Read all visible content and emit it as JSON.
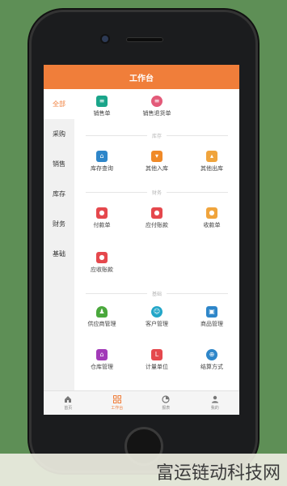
{
  "header": {
    "title": "工作台"
  },
  "sidebar": {
    "items": [
      {
        "label": "全部",
        "active": true
      },
      {
        "label": "采购"
      },
      {
        "label": "销售"
      },
      {
        "label": "库存"
      },
      {
        "label": "财务"
      },
      {
        "label": "基础"
      }
    ]
  },
  "sections": {
    "inventory": "库存",
    "finance": "财务",
    "basic": "基础"
  },
  "modules": {
    "sales_order": {
      "label": "销售单",
      "icon": "clipboard-icon",
      "color": "#1aa58a"
    },
    "sales_return": {
      "label": "销售退货单",
      "icon": "return-list-icon",
      "color": "#e35a79"
    },
    "stock_query": {
      "label": "库存查询",
      "icon": "house-search-icon",
      "color": "#2e86c9"
    },
    "other_in": {
      "label": "其他入库",
      "icon": "box-in-icon",
      "color": "#f08a28"
    },
    "other_out": {
      "label": "其他出库",
      "icon": "box-out-icon",
      "color": "#f0a43c"
    },
    "payment": {
      "label": "付款单",
      "icon": "money-bag-icon",
      "color": "#e5484d"
    },
    "payable": {
      "label": "应付账款",
      "icon": "money-bag-icon",
      "color": "#e5484d"
    },
    "receipt": {
      "label": "收款单",
      "icon": "money-bag-icon",
      "color": "#f0a43c"
    },
    "receivable": {
      "label": "应收账款",
      "icon": "money-bag-icon",
      "color": "#e5484d"
    },
    "supplier": {
      "label": "供应商管理",
      "icon": "person-icon",
      "color": "#4aa83c"
    },
    "customer": {
      "label": "客户管理",
      "icon": "smile-icon",
      "color": "#22a6c8"
    },
    "product": {
      "label": "商品管理",
      "icon": "bag-icon",
      "color": "#2e86c9"
    },
    "warehouse": {
      "label": "仓库管理",
      "icon": "home-icon",
      "color": "#a23ab8"
    },
    "unit": {
      "label": "计量单位",
      "icon": "unit-icon",
      "color": "#e5484d"
    },
    "settlement": {
      "label": "结算方式",
      "icon": "target-icon",
      "color": "#2e86c9"
    }
  },
  "tabbar": [
    {
      "label": "首页",
      "icon": "home-icon"
    },
    {
      "label": "工作台",
      "icon": "grid-icon",
      "active": true
    },
    {
      "label": "报表",
      "icon": "pie-chart-icon"
    },
    {
      "label": "我的",
      "icon": "user-icon"
    }
  ],
  "watermark": "富运链动科技网"
}
